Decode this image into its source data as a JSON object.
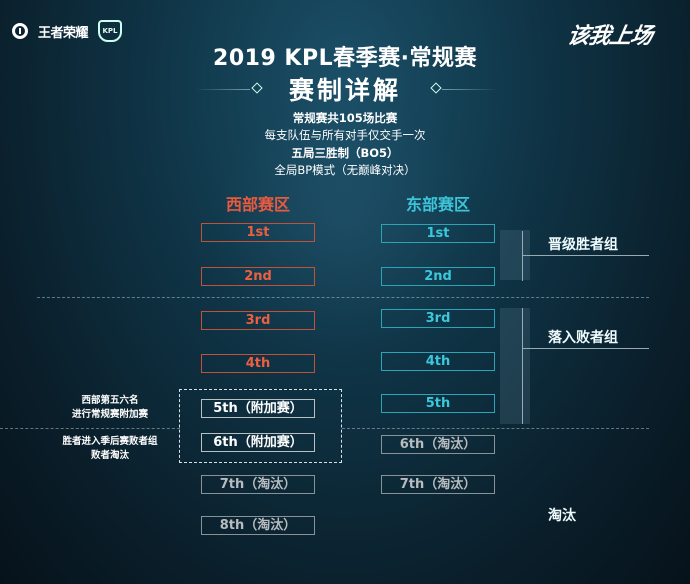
{
  "header": {
    "brand_logo_text": "王者荣耀",
    "league_logo_text": "KPL",
    "slogan": "该我上场",
    "title": "2019 KPL春季赛·常规赛",
    "subtitle": "赛制详解"
  },
  "info": [
    {
      "text": "常规赛共105场比赛",
      "bold": true
    },
    {
      "text": "每支队伍与所有对手仅交手一次",
      "bold": false
    },
    {
      "text": "五局三胜制（BO5）",
      "bold": true
    },
    {
      "text": "全局BP模式（无巅峰对决）",
      "bold": false
    }
  ],
  "zones": {
    "west": {
      "title": "西部赛区",
      "color": "#ea5a3f",
      "slots": [
        "1st",
        "2nd",
        "3rd",
        "4th",
        "5th（附加赛）",
        "6th（附加赛）",
        "7th（淘汰）",
        "8th（淘汰）"
      ]
    },
    "east": {
      "title": "东部赛区",
      "color": "#3cc4d8",
      "slots": [
        "1st",
        "2nd",
        "3rd",
        "4th",
        "5th",
        "6th（淘汰）",
        "7th（淘汰）"
      ]
    }
  },
  "groups": {
    "winners": "晋级胜者组",
    "losers": "落入败者组",
    "eliminated": "淘汰"
  },
  "notes": {
    "playoff_line1": "西部第五六名",
    "playoff_line2": "进行常规赛附加赛",
    "result_line1": "胜者进入季后赛败者组",
    "result_line2": "败者淘汰"
  }
}
